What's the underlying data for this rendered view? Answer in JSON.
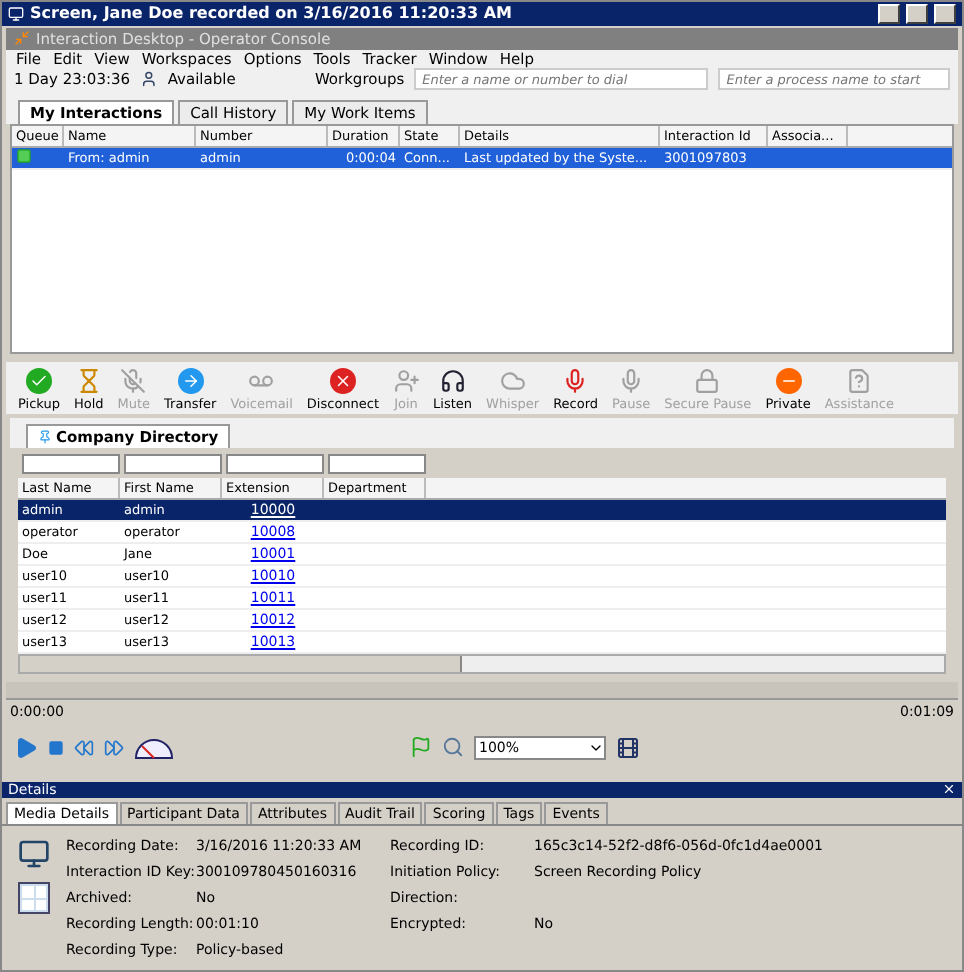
{
  "window": {
    "title": "Screen, Jane Doe recorded on 3/16/2016 11:20:33 AM"
  },
  "app": {
    "title": "Interaction Desktop - Operator Console"
  },
  "menu": [
    "File",
    "Edit",
    "View",
    "Workspaces",
    "Options",
    "Tools",
    "Tracker",
    "Window",
    "Help"
  ],
  "toolbar": {
    "timer": "1 Day 23:03:36",
    "status": "Available",
    "workgroups": "Workgroups",
    "dial_placeholder": "Enter a name or number to dial",
    "process_placeholder": "Enter a process name to start"
  },
  "tabs": [
    {
      "label": "My Interactions",
      "selected": true
    },
    {
      "label": "Call History",
      "selected": false
    },
    {
      "label": "My Work Items",
      "selected": false
    }
  ],
  "interactions": {
    "columns": [
      "Queue",
      "Name",
      "Number",
      "Duration",
      "State",
      "Details",
      "Interaction Id",
      "Associa..."
    ],
    "rows": [
      {
        "name": "From: admin",
        "number": "admin",
        "duration": "0:00:04",
        "state": "Conn...",
        "details": "Last updated by the Syste...",
        "interaction_id": "3001097803",
        "selected": true
      }
    ]
  },
  "call_controls": [
    {
      "kind": "pickup",
      "label": "Pickup",
      "disabled": false
    },
    {
      "kind": "hold",
      "label": "Hold",
      "disabled": false
    },
    {
      "kind": "mute",
      "label": "Mute",
      "disabled": true
    },
    {
      "kind": "transfer",
      "label": "Transfer",
      "disabled": false
    },
    {
      "kind": "voicemail",
      "label": "Voicemail",
      "disabled": true
    },
    {
      "kind": "disconnect",
      "label": "Disconnect",
      "disabled": false
    },
    {
      "kind": "join",
      "label": "Join",
      "disabled": true
    },
    {
      "kind": "listen",
      "label": "Listen",
      "disabled": false
    },
    {
      "kind": "whisper",
      "label": "Whisper",
      "disabled": true
    },
    {
      "kind": "record",
      "label": "Record",
      "disabled": false
    },
    {
      "kind": "pause",
      "label": "Pause",
      "disabled": true
    },
    {
      "kind": "secure",
      "label": "Secure Pause",
      "disabled": true
    },
    {
      "kind": "private",
      "label": "Private",
      "disabled": false
    },
    {
      "kind": "assistance",
      "label": "Assistance",
      "disabled": true
    }
  ],
  "directory": {
    "tab": "Company Directory",
    "columns": [
      "Last Name",
      "First Name",
      "Extension",
      "Department"
    ],
    "rows": [
      {
        "last": "admin",
        "first": "admin",
        "extension": "10000",
        "selected": true
      },
      {
        "last": "operator",
        "first": "operator",
        "extension": "10008",
        "selected": false
      },
      {
        "last": "Doe",
        "first": "Jane",
        "extension": "10001",
        "selected": false
      },
      {
        "last": "user10",
        "first": "user10",
        "extension": "10010",
        "selected": false
      },
      {
        "last": "user11",
        "first": "user11",
        "extension": "10011",
        "selected": false
      },
      {
        "last": "user12",
        "first": "user12",
        "extension": "10012",
        "selected": false
      },
      {
        "last": "user13",
        "first": "user13",
        "extension": "10013",
        "selected": false
      }
    ]
  },
  "player": {
    "start": "0:00:00",
    "end": "0:01:09",
    "zoom": "100%"
  },
  "details": {
    "title": "Details",
    "tabs": [
      {
        "label": "Media Details",
        "selected": true
      },
      {
        "label": "Participant Data",
        "selected": false
      },
      {
        "label": "Attributes",
        "selected": false
      },
      {
        "label": "Audit Trail",
        "selected": false
      },
      {
        "label": "Scoring",
        "selected": false
      },
      {
        "label": "Tags",
        "selected": false
      },
      {
        "label": "Events",
        "selected": false
      }
    ],
    "rows": [
      {
        "label": "Recording Date:",
        "value": "3/16/2016 11:20:33 AM",
        "label2": "Recording ID:",
        "value2": "165c3c14-52f2-d8f6-056d-0fc1d4ae0001"
      },
      {
        "label": "Interaction ID Key:",
        "value": "300109780450160316",
        "label2": "Initiation Policy:",
        "value2": "Screen Recording Policy"
      },
      {
        "label": "Archived:",
        "value": "No",
        "label2": "Direction:"
      },
      {
        "label": "Recording Length:",
        "value": "00:01:10",
        "label2": "Encrypted:",
        "value2": "No"
      },
      {
        "label": "Recording Type:",
        "value": "Policy-based"
      }
    ]
  }
}
